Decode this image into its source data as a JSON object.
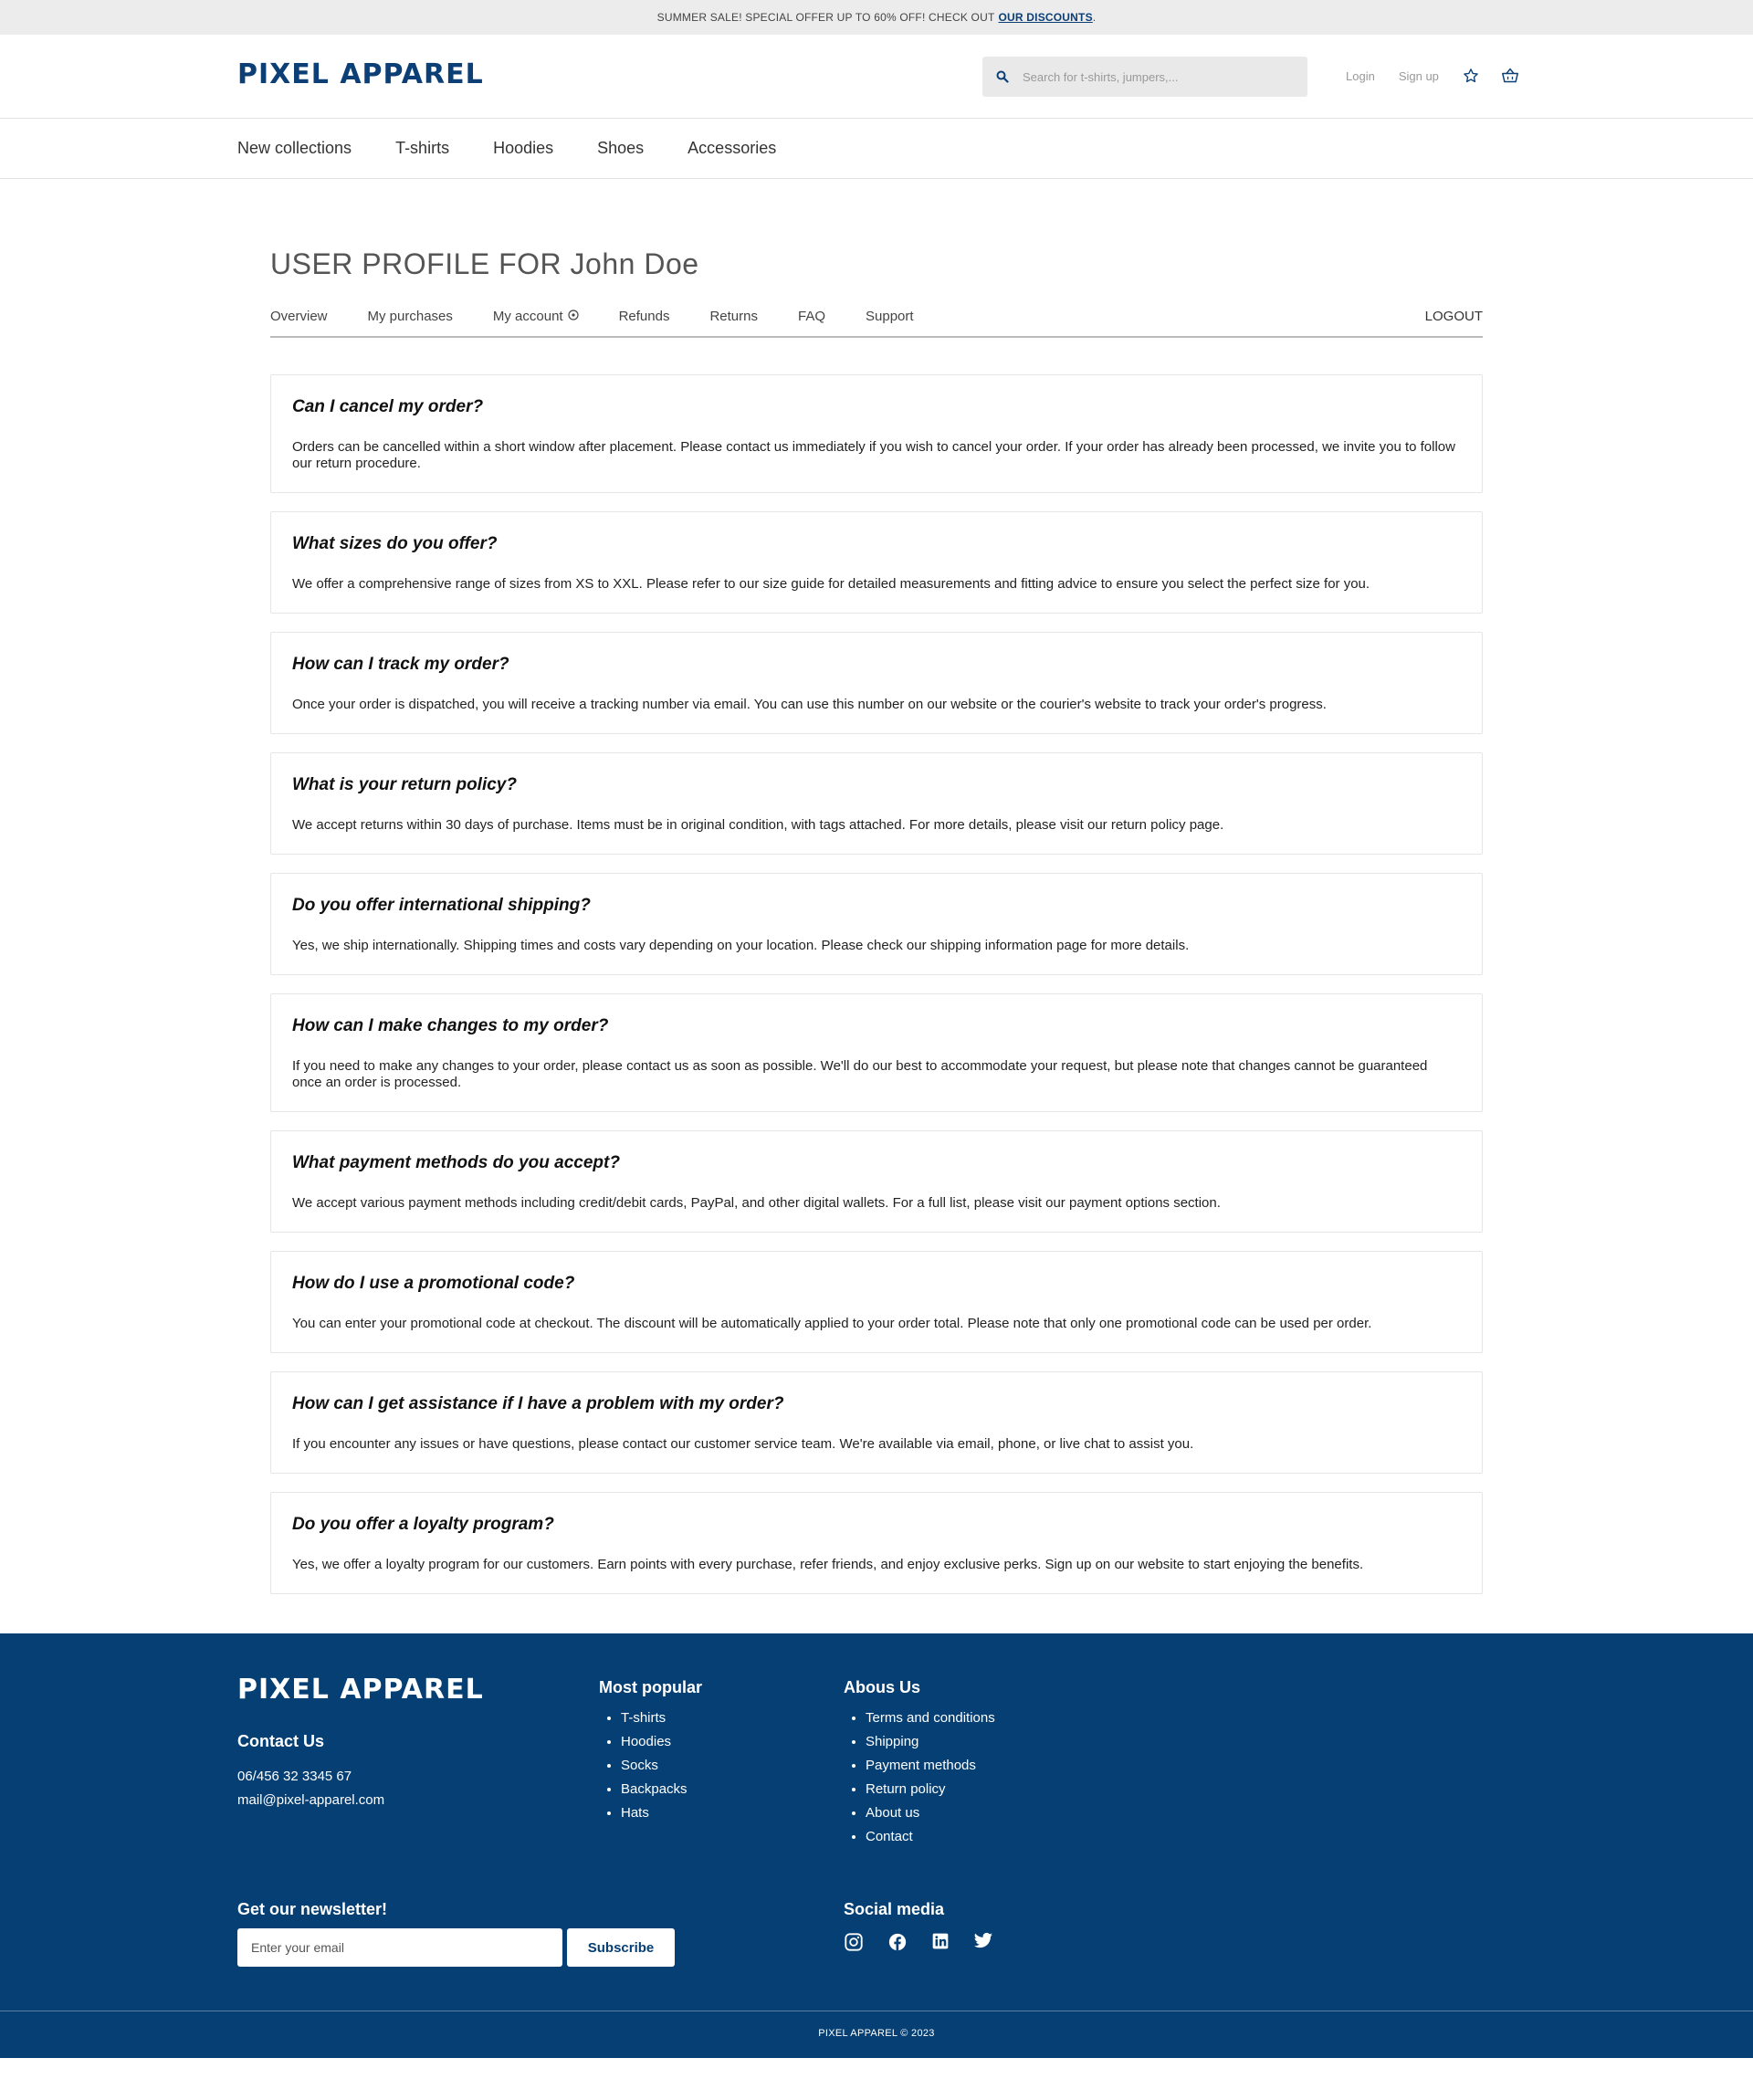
{
  "promo": {
    "text": "SUMMER SALE! SPECIAL OFFER UP TO 60% OFF! CHECK OUT",
    "link": "OUR DISCOUNTS",
    "suffix": "."
  },
  "brand": {
    "name": "PIXEL APPAREL",
    "color": "#0b3f75"
  },
  "search": {
    "placeholder": "Search for t-shirts, jumpers,..."
  },
  "header_links": {
    "login": "Login",
    "signup": "Sign up"
  },
  "icons": {
    "search": "search-icon",
    "favorites": "star-icon",
    "cart": "basket-icon"
  },
  "categories": [
    "New collections",
    "T-shirts",
    "Hoodies",
    "Shoes",
    "Accessories"
  ],
  "profile": {
    "title": "USER PROFILE FOR John Doe"
  },
  "tabs": {
    "overview": "Overview",
    "purchases": "My purchases",
    "account": "My account",
    "refunds": "Refunds",
    "returns": "Returns",
    "faq": "FAQ",
    "support": "Support",
    "logout": "LOGOUT"
  },
  "faqs": [
    {
      "q": "Can I cancel my order?",
      "a": "Orders can be cancelled within a short window after placement. Please contact us immediately if you wish to cancel your order. If your order has already been processed, we invite you to follow our return procedure."
    },
    {
      "q": "What sizes do you offer?",
      "a": "We offer a comprehensive range of sizes from XS to XXL. Please refer to our size guide for detailed measurements and fitting advice to ensure you select the perfect size for you."
    },
    {
      "q": "How can I track my order?",
      "a": "Once your order is dispatched, you will receive a tracking number via email. You can use this number on our website or the courier's website to track your order's progress."
    },
    {
      "q": "What is your return policy?",
      "a": "We accept returns within 30 days of purchase. Items must be in original condition, with tags attached. For more details, please visit our return policy page."
    },
    {
      "q": "Do you offer international shipping?",
      "a": "Yes, we ship internationally. Shipping times and costs vary depending on your location. Please check our shipping information page for more details."
    },
    {
      "q": "How can I make changes to my order?",
      "a": "If you need to make any changes to your order, please contact us as soon as possible. We'll do our best to accommodate your request, but please note that changes cannot be guaranteed once an order is processed."
    },
    {
      "q": "What payment methods do you accept?",
      "a": "We accept various payment methods including credit/debit cards, PayPal, and other digital wallets. For a full list, please visit our payment options section."
    },
    {
      "q": "How do I use a promotional code?",
      "a": "You can enter your promotional code at checkout. The discount will be automatically applied to your order total. Please note that only one promotional code can be used per order."
    },
    {
      "q": "How can I get assistance if I have a problem with my order?",
      "a": "If you encounter any issues or have questions, please contact our customer service team. We're available via email, phone, or live chat to assist you."
    },
    {
      "q": "Do you offer a loyalty program?",
      "a": "Yes, we offer a loyalty program for our customers. Earn points with every purchase, refer friends, and enjoy exclusive perks. Sign up on our website to start enjoying the benefits."
    }
  ],
  "footer": {
    "bg_color": "#053f73",
    "contact_heading": "Contact Us",
    "phone": "06/456 32 3345 67",
    "email": "mail@pixel-apparel.com",
    "popular_heading": "Most popular",
    "popular": [
      "T-shirts",
      "Hoodies",
      "Socks",
      "Backpacks",
      "Hats"
    ],
    "about_heading": "Abous Us",
    "about": [
      "Terms and conditions",
      "Shipping",
      "Payment methods",
      "Return policy",
      "About us",
      "Contact"
    ],
    "newsletter_heading": "Get our newsletter!",
    "newsletter_placeholder": "Enter your email",
    "subscribe": "Subscribe",
    "social_heading": "Social media",
    "social_icons": [
      "instagram-icon",
      "facebook-icon",
      "linkedin-icon",
      "twitter-icon"
    ],
    "copyright": "PIXEL APPAREL © 2023"
  }
}
